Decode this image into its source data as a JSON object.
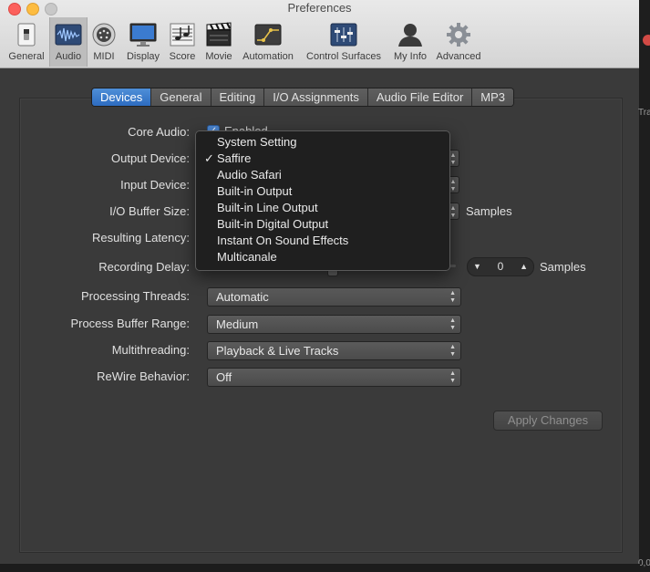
{
  "window": {
    "title": "Preferences"
  },
  "toolbar": {
    "items": [
      {
        "label": "General",
        "icon": "switch-icon"
      },
      {
        "label": "Audio",
        "icon": "waveform-icon",
        "selected": true
      },
      {
        "label": "MIDI",
        "icon": "midi-connector-icon"
      },
      {
        "label": "Display",
        "icon": "monitor-icon"
      },
      {
        "label": "Score",
        "icon": "score-notes-icon"
      },
      {
        "label": "Movie",
        "icon": "clapperboard-icon"
      },
      {
        "label": "Automation",
        "icon": "automation-curve-icon"
      },
      {
        "label": "Control Surfaces",
        "icon": "faders-icon"
      },
      {
        "label": "My Info",
        "icon": "person-icon"
      },
      {
        "label": "Advanced",
        "icon": "gear-icon"
      }
    ]
  },
  "tabs": [
    "Devices",
    "General",
    "Editing",
    "I/O Assignments",
    "Audio File Editor",
    "MP3"
  ],
  "active_tab": "Devices",
  "form": {
    "core_audio": {
      "label": "Core Audio:",
      "checkbox_label": "Enabled",
      "checked": true
    },
    "output_device": {
      "label": "Output Device:"
    },
    "input_device": {
      "label": "Input Device:"
    },
    "io_buffer_size": {
      "label": "I/O Buffer Size:",
      "suffix": "Samples"
    },
    "resulting_latency": {
      "label": "Resulting Latency:"
    },
    "recording_delay": {
      "label": "Recording Delay:",
      "value": "0",
      "suffix": "Samples"
    },
    "processing_threads": {
      "label": "Processing Threads:",
      "value": "Automatic"
    },
    "process_buffer_range": {
      "label": "Process Buffer Range:",
      "value": "Medium"
    },
    "multithreading": {
      "label": "Multithreading:",
      "value": "Playback & Live Tracks"
    },
    "rewire_behavior": {
      "label": "ReWire Behavior:",
      "value": "Off"
    }
  },
  "apply_button": "Apply Changes",
  "output_device_menu": {
    "options": [
      "System Setting",
      "Saffire",
      "Audio Safari",
      "Built-in Output",
      "Built-in Line Output",
      "Built-in Digital Output",
      "Instant On Sound Effects",
      "Multicanale"
    ],
    "selected": "Saffire",
    "check_glyph": "✓"
  },
  "background_snippets": {
    "tra": "Tra",
    "num": "0,0"
  },
  "colors": {
    "accent": "#2d6cc0",
    "panel": "#3a3a3a",
    "titlebar": "#dcdcdc"
  }
}
